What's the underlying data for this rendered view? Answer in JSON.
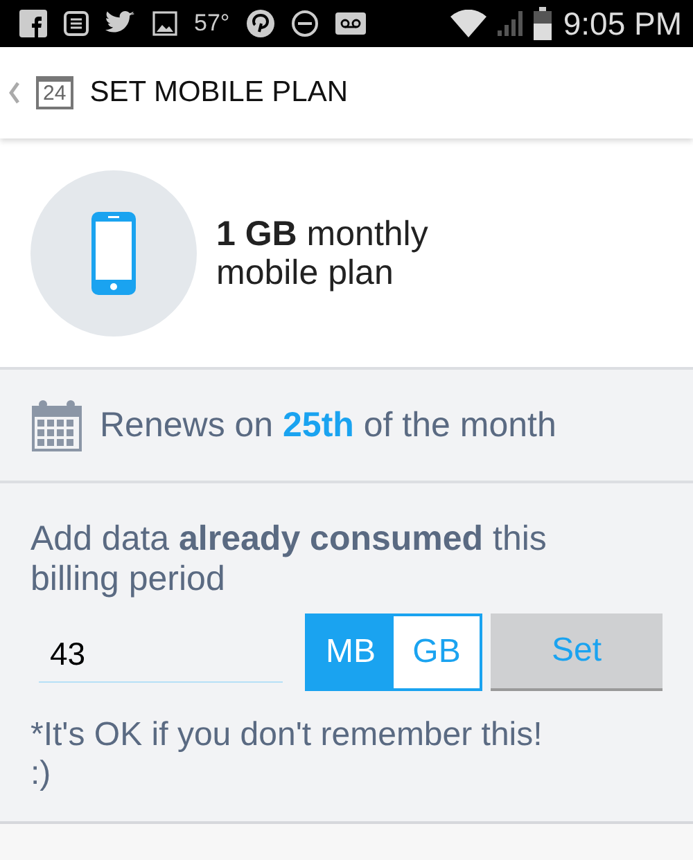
{
  "status_bar": {
    "temperature": "57°",
    "time": "9:05 PM"
  },
  "header": {
    "calendar_day": "24",
    "title": "SET MOBILE PLAN"
  },
  "plan": {
    "text": "**1 GB** monthly mobile plan"
  },
  "renewal": {
    "text": "Renews on **25th** of the month"
  },
  "consumed": {
    "prompt": "Add data **already consumed** this billing period",
    "value": "43",
    "units": [
      {
        "label": "MB",
        "selected": true
      },
      {
        "label": "GB",
        "selected": false
      }
    ],
    "set_button": "Set",
    "note": "*It's OK if you don't remember this! :)"
  }
}
